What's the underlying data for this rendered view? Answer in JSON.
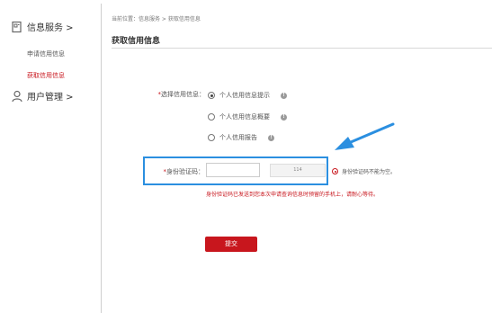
{
  "sidebar": {
    "group1_label": "信息服务 >",
    "items": [
      {
        "label": "申请信用信息"
      },
      {
        "label": "获取信用信息"
      }
    ],
    "group2_label": "用户管理 >"
  },
  "breadcrumb": "当前位置：信息服务 > 获取信用信息",
  "page_title": "获取信用信息",
  "form": {
    "credit_label": "选择信用信息：",
    "required_mark": "*",
    "options": [
      {
        "label": "个人信用信息提示",
        "checked": true
      },
      {
        "label": "个人信用信息概要",
        "checked": false
      },
      {
        "label": "个人信用报告",
        "checked": false
      }
    ],
    "info_icon_glyph": "!",
    "id_code_label": "身份验证码：",
    "id_code_value": "",
    "code_display": "114",
    "error_text": "身份验证码不能为空。",
    "hint_text": "身份验证码已发送到您本次申请查询信息时预留的手机上，请耐心等待。",
    "submit_label": "提交"
  },
  "colors": {
    "accent": "#c8161d",
    "highlight": "#2b8fe0"
  }
}
